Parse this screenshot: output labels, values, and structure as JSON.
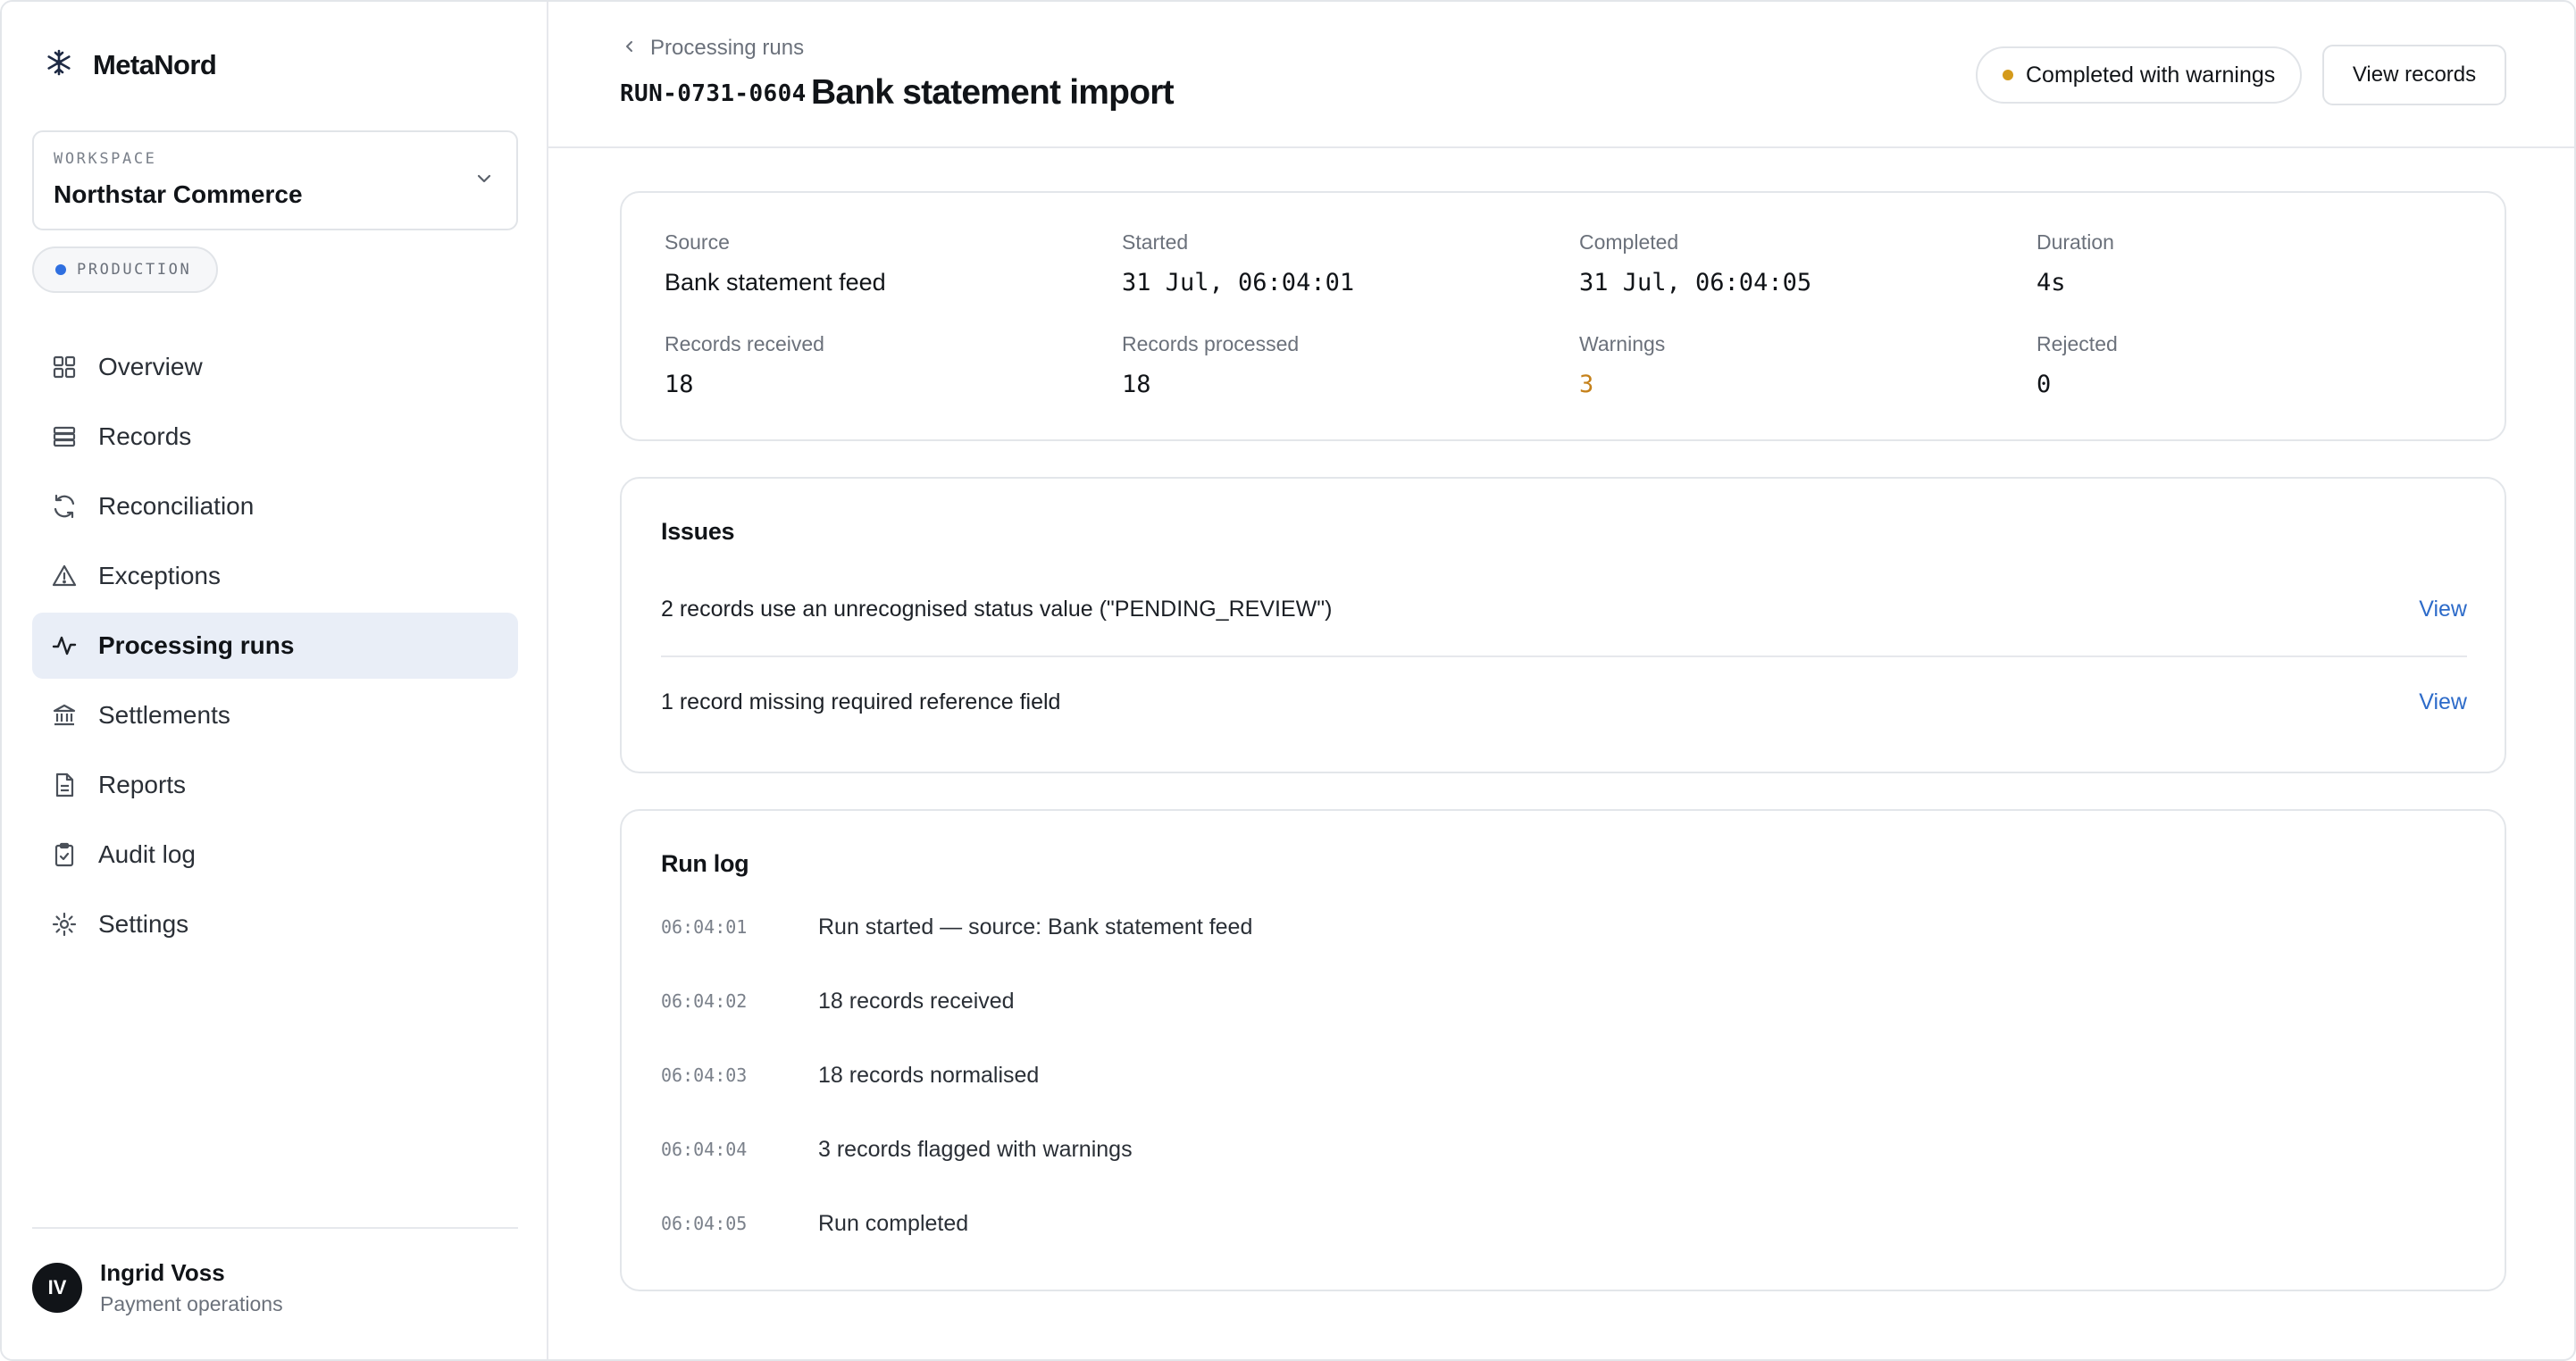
{
  "brand": {
    "name": "MetaNord",
    "icon": "snowflake-icon"
  },
  "workspace": {
    "label": "WORKSPACE",
    "name": "Northstar Commerce"
  },
  "environment": {
    "label": "PRODUCTION",
    "color": "#2f6fe0"
  },
  "sidebar": {
    "items": [
      {
        "label": "Overview",
        "icon": "grid-icon",
        "active": false
      },
      {
        "label": "Records",
        "icon": "database-icon",
        "active": false
      },
      {
        "label": "Reconciliation",
        "icon": "refresh-icon",
        "active": false
      },
      {
        "label": "Exceptions",
        "icon": "warning-triangle-icon",
        "active": false
      },
      {
        "label": "Processing runs",
        "icon": "activity-icon",
        "active": true
      },
      {
        "label": "Settlements",
        "icon": "bank-icon",
        "active": false
      },
      {
        "label": "Reports",
        "icon": "document-icon",
        "active": false
      },
      {
        "label": "Audit log",
        "icon": "clipboard-check-icon",
        "active": false
      },
      {
        "label": "Settings",
        "icon": "gear-icon",
        "active": false
      }
    ]
  },
  "user": {
    "initials": "IV",
    "name": "Ingrid Voss",
    "role": "Payment operations"
  },
  "header": {
    "breadcrumb": "Processing runs",
    "run_id": "RUN-0731-0604",
    "title": "Bank statement import",
    "status": "Completed with warnings",
    "status_color": "#d49a1b",
    "action_label": "View records"
  },
  "summary": {
    "source": {
      "label": "Source",
      "value": "Bank statement feed"
    },
    "started": {
      "label": "Started",
      "value": "31 Jul, 06:04:01"
    },
    "completed": {
      "label": "Completed",
      "value": "31 Jul, 06:04:05"
    },
    "duration": {
      "label": "Duration",
      "value": "4s"
    },
    "received": {
      "label": "Records received",
      "value": "18"
    },
    "processed": {
      "label": "Records processed",
      "value": "18"
    },
    "warnings": {
      "label": "Warnings",
      "value": "3",
      "color": "#c5811a"
    },
    "rejected": {
      "label": "Rejected",
      "value": "0"
    }
  },
  "issues": {
    "title": "Issues",
    "items": [
      {
        "text": "2 records use an unrecognised status value (\"PENDING_REVIEW\")",
        "link": "View"
      },
      {
        "text": "1 record missing required reference field",
        "link": "View"
      }
    ]
  },
  "runlog": {
    "title": "Run log",
    "entries": [
      {
        "time": "06:04:01",
        "message": "Run started — source: Bank statement feed"
      },
      {
        "time": "06:04:02",
        "message": "18 records received"
      },
      {
        "time": "06:04:03",
        "message": "18 records normalised"
      },
      {
        "time": "06:04:04",
        "message": "3 records flagged with warnings"
      },
      {
        "time": "06:04:05",
        "message": "Run completed"
      }
    ]
  }
}
